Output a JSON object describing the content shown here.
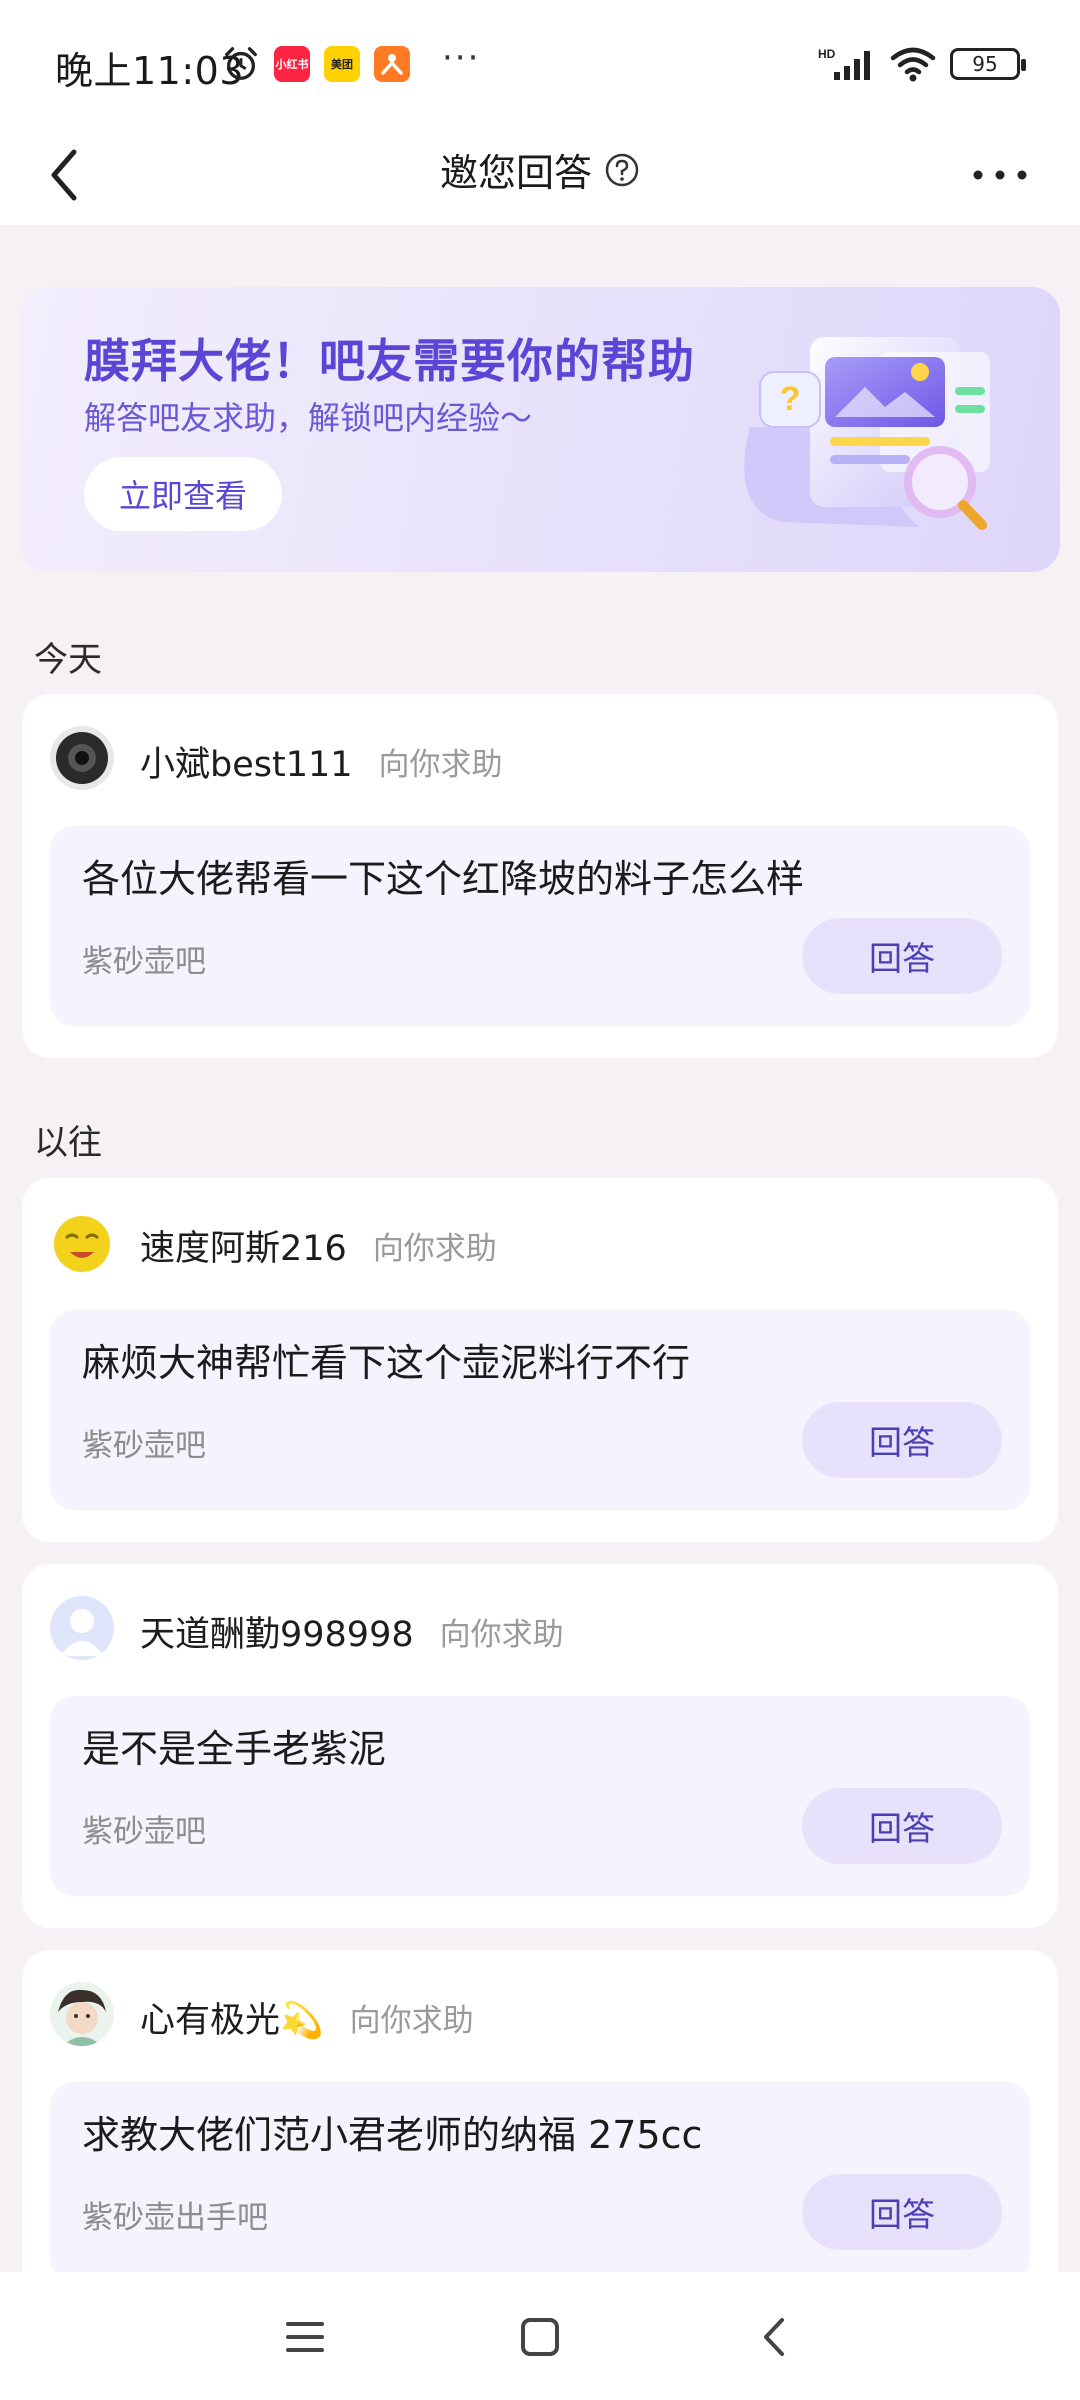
{
  "status_bar": {
    "time": "晚上11:03",
    "badge_xhs": "小红书",
    "badge_meituan": "美团",
    "more_dots": "···",
    "network": "HD",
    "battery": "95"
  },
  "nav": {
    "title": "邀您回答"
  },
  "banner": {
    "title": "膜拜大佬！吧友需要你的帮助",
    "subtitle": "解答吧友求助，解锁吧内经验～",
    "button": "立即查看"
  },
  "sections": {
    "today": "今天",
    "past": "以往"
  },
  "help_tag": "向你求助",
  "answer_label": "回答",
  "cards": [
    {
      "user": "小斌best111",
      "question": "各位大佬帮看一下这个红降坡的料子怎么样",
      "bar": "紫砂壶吧"
    },
    {
      "user": "速度阿斯216",
      "question": "麻烦大神帮忙看下这个壶泥料行不行",
      "bar": "紫砂壶吧"
    },
    {
      "user": "天道酬勤998998",
      "question": "是不是全手老紫泥",
      "bar": "紫砂壶吧"
    },
    {
      "user": "心有极光💫",
      "question": "求教大佬们范小君老师的纳福 275cc",
      "bar": "紫砂壶出手吧"
    }
  ],
  "colors": {
    "accent": "#5a45d6",
    "answer_bg": "#e7e1fb",
    "page_bg": "#f6f1f5"
  }
}
